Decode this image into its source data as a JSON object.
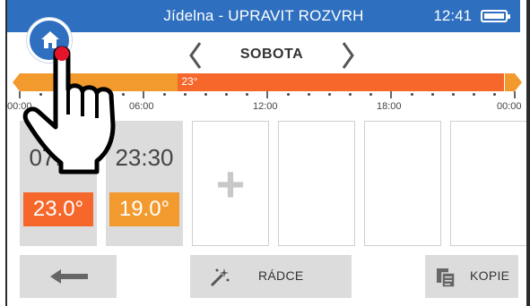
{
  "header": {
    "title": "Jídelna - UPRAVIT ROZVRH",
    "time": "12:41",
    "bg_color": "#2e6fbf"
  },
  "home": {
    "icon": "home-icon"
  },
  "day_nav": {
    "prev_icon": "chevron-left-icon",
    "day": "SOBOTA",
    "next_icon": "chevron-right-icon"
  },
  "timeline": {
    "segments": [
      {
        "from": "00:00",
        "to": "07:40",
        "temp": "",
        "color": "#f29a2e"
      },
      {
        "from": "07:40",
        "to": "23:30",
        "temp": "23°",
        "color": "#f5672a"
      },
      {
        "from": "23:30",
        "to": "24:00",
        "temp": "",
        "color": "#f29a2e"
      }
    ],
    "hour_labels": [
      "00:00",
      "06:00",
      "12:00",
      "18:00",
      "00:00"
    ]
  },
  "slots": [
    {
      "time": "07:40",
      "temp": "23.0°",
      "temp_color": "#f5672a"
    },
    {
      "time": "23:30",
      "temp": "19.0°",
      "temp_color": "#f29a2e"
    }
  ],
  "empty_slots": {
    "add_symbol": "+"
  },
  "buttons": {
    "back_icon": "arrow-left-icon",
    "wizard_label": "RÁDCE",
    "wizard_icon": "magic-wand-icon",
    "copy_label": "KOPIE",
    "copy_icon": "copy-icon"
  },
  "overlay": {
    "icon": "pointing-hand-cursor-icon"
  }
}
